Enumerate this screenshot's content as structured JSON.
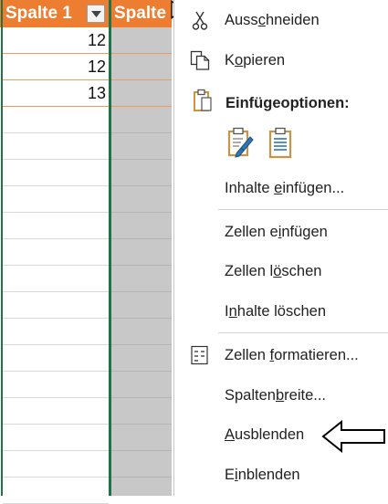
{
  "sheet": {
    "column_a": {
      "header": "Spalte 1",
      "values": [
        "12",
        "12",
        "13"
      ]
    },
    "column_b": {
      "header": "Spalte"
    }
  },
  "context_menu": {
    "cut": {
      "before": "Auss",
      "key": "c",
      "after": "hneiden"
    },
    "copy": {
      "before": "K",
      "key": "o",
      "after": "pieren"
    },
    "paste_options_title": "Einfügeoptionen:",
    "paste_special": {
      "before": "Inhalte ",
      "key": "e",
      "after": "infügen..."
    },
    "insert_cells": {
      "before": "Zellen e",
      "key": "i",
      "after": "nfügen"
    },
    "delete_cells": {
      "before": "Zellen l",
      "key": "ö",
      "after": "schen"
    },
    "clear_contents": {
      "before": "I",
      "key": "n",
      "after": "halte löschen"
    },
    "format_cells": {
      "before": "Zellen ",
      "key": "f",
      "after": "ormatieren..."
    },
    "column_width": {
      "before": "Spalten",
      "key": "b",
      "after": "reite..."
    },
    "hide": {
      "before": "",
      "key": "A",
      "after": "usblenden"
    },
    "unhide": {
      "before": "E",
      "key": "i",
      "after": "nblenden"
    }
  },
  "colors": {
    "table_header": "#ed7d31",
    "selection_border": "#217346",
    "hidden_column": "#c8c8c8"
  },
  "icons": {
    "cut": "scissors-icon",
    "copy": "copy-icon",
    "paste_options": "clipboard-icon",
    "paste_formatting": "paste-brush-icon",
    "paste_values": "paste-clipboard-icon",
    "format_cells": "format-cells-icon",
    "filter": "dropdown-arrow-icon"
  }
}
